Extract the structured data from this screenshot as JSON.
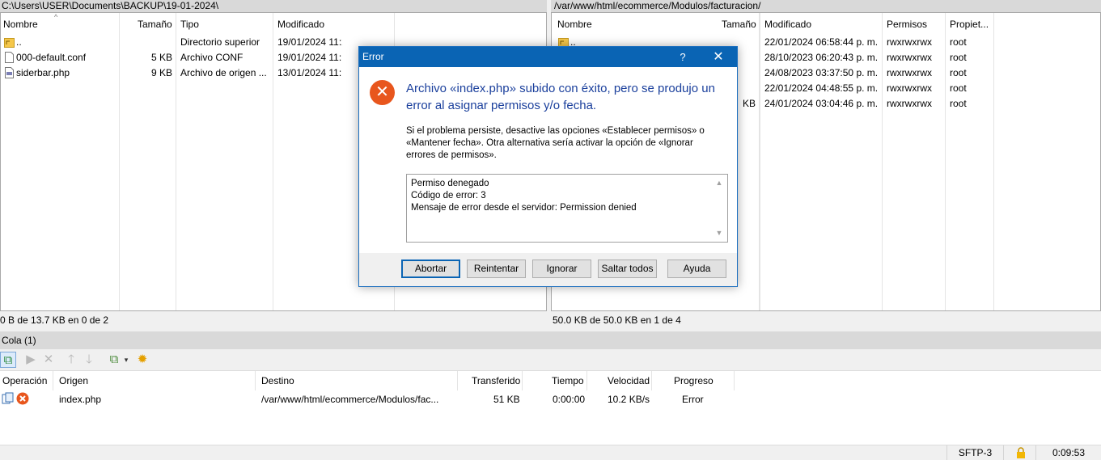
{
  "local": {
    "path": "C:\\Users\\USER\\Documents\\BACKUP\\19-01-2024\\",
    "columns": [
      "Nombre",
      "Tamaño",
      "Tipo",
      "Modificado"
    ],
    "files": [
      {
        "name": "..",
        "size": "",
        "type": "Directorio superior",
        "modified": "19/01/2024 11:22:49 a. m.",
        "icon": "parent-folder-icon"
      },
      {
        "name": "000-default.conf",
        "size": "5 KB",
        "type": "Archivo CONF",
        "modified": "19/01/2024 11:11:28 a. m.",
        "icon": "file-icon"
      },
      {
        "name": "siderbar.php",
        "size": "9 KB",
        "type": "Archivo de origen ...",
        "modified": "13/01/2024 11:18:48 a. m.",
        "icon": "php-file-icon"
      }
    ],
    "status": "0 B de 13.7 KB en 0 de 2"
  },
  "remote": {
    "path": "/var/www/html/ecommerce/Modulos/facturacion/",
    "columns": [
      "Nombre",
      "Tamaño",
      "Modificado",
      "Permisos",
      "Propiet..."
    ],
    "files": [
      {
        "name": "..",
        "size": "",
        "modified": "22/01/2024 06:58:44 p. m.",
        "perms": "rwxrwxrwx",
        "owner": "root"
      },
      {
        "name": "",
        "size": "",
        "modified": "28/10/2023 06:20:43 p. m.",
        "perms": "rwxrwxrwx",
        "owner": "root"
      },
      {
        "name": "",
        "size": "",
        "modified": "24/08/2023 03:37:50 p. m.",
        "perms": "rwxrwxrwx",
        "owner": "root"
      },
      {
        "name": "",
        "size": "",
        "modified": "22/01/2024 04:48:55 p. m.",
        "perms": "rwxrwxrwx",
        "owner": "root"
      },
      {
        "name": "",
        "size": "KB",
        "modified": "24/01/2024 03:04:46 p. m.",
        "perms": "rwxrwxrwx",
        "owner": "root"
      }
    ],
    "status": "50.0 KB de 50.0 KB en 1 de 4"
  },
  "queue": {
    "title": "Cola (1)",
    "columns": [
      "Operación",
      "Origen",
      "Destino",
      "Transferido",
      "Tiempo",
      "Velocidad",
      "Progreso"
    ],
    "items": [
      {
        "origin": "index.php",
        "destination": "/var/www/html/ecommerce/Modulos/fac...",
        "transferred": "51 KB",
        "time": "0:00:00",
        "speed": "10.2 KB/s",
        "progress": "Error"
      }
    ]
  },
  "statusbar": {
    "protocol": "SFTP-3",
    "time": "0:09:53"
  },
  "dialog": {
    "title": "Error",
    "help": "?",
    "close": "✕",
    "main_line1": "Archivo «index.php» subido con éxito, pero se produjo un",
    "main_line2": "error al asignar permisos y/o fecha.",
    "sub_line1": "Si el problema persiste, desactive las opciones «Establecer permisos» o",
    "sub_line2": "«Mantener fecha». Otra alternativa sería activar la opción de «Ignorar",
    "sub_line3": "errores de permisos».",
    "details": [
      "Permiso denegado",
      "Código de error: 3",
      "Mensaje de error desde el servidor: Permission denied"
    ],
    "buttons": {
      "abort": "Abortar",
      "retry": "Reintentar",
      "ignore": "Ignorar",
      "skip_all": "Saltar todos",
      "help": "Ayuda"
    }
  },
  "colors": {
    "accent": "#0a64b4",
    "error": "#e8561d",
    "message": "#1a3f9c"
  }
}
